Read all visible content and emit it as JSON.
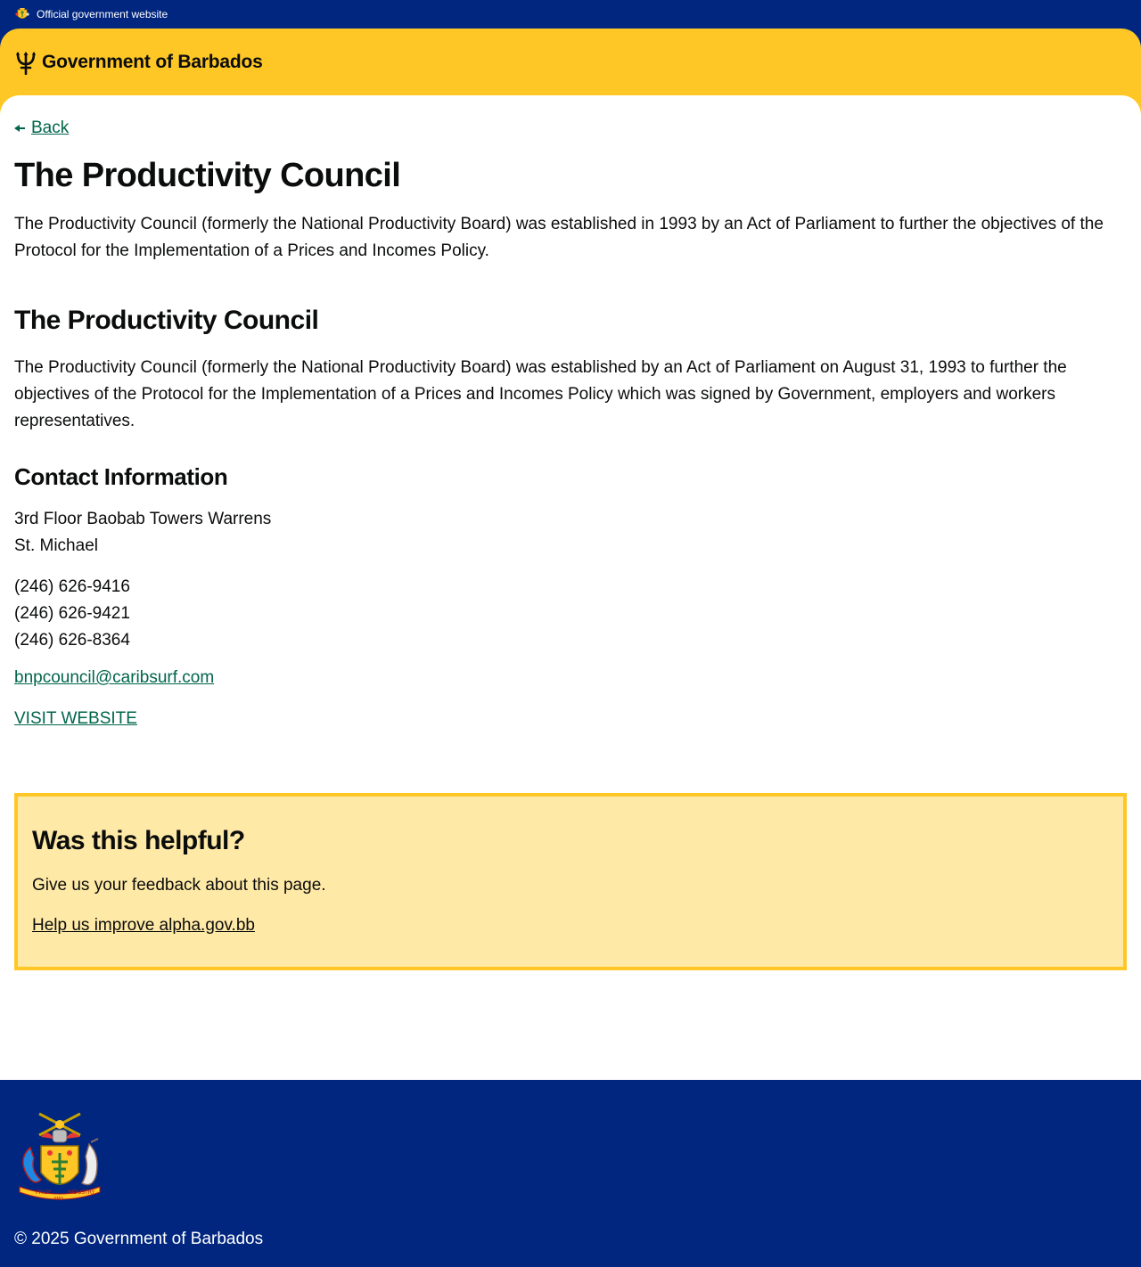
{
  "topbar": {
    "official_label": "Official government website"
  },
  "header": {
    "brand_name": "Government of Barbados"
  },
  "nav": {
    "back_label": "Back"
  },
  "page": {
    "title": "The Productivity Council",
    "lead": "The Productivity Council (formerly the National Productivity Board) was established in 1993 by an Act of Parliament to further the objectives of the Protocol for the Implementation of a Prices and Incomes Policy.",
    "section_heading": "The Productivity Council",
    "section_body": "The Productivity Council (formerly the National Productivity Board) was established by an Act of Parliament on August 31, 1993 to further the objectives of the Protocol for the Implementation of a Prices and Incomes Policy which was signed by Government, employers and workers representatives."
  },
  "contact": {
    "heading": "Contact Information",
    "address_line1": "3rd Floor Baobab Towers Warrens",
    "address_line2": "St. Michael",
    "phones": [
      "(246) 626-9416",
      "(246) 626-9421",
      "(246) 626-8364"
    ],
    "email": "bnpcouncil@caribsurf.com",
    "website_label": "VISIT WEBSITE"
  },
  "feedback": {
    "heading": "Was this helpful?",
    "text": "Give us your feedback about this page.",
    "link_label": "Help us improve alpha.gov.bb"
  },
  "footer": {
    "copyright": "© 2025 Government of Barbados",
    "coat_motto": [
      "PRIDE",
      "AND",
      "INDUSTRY"
    ]
  },
  "colors": {
    "navy": "#00267f",
    "gold": "#ffc726",
    "link_green": "#00654a",
    "feedback_bg": "#ffe9a6"
  },
  "icons": {
    "topbar": "barbados-crest-icon",
    "brand": "trident-icon",
    "back": "arrow-left-icon",
    "footer": "coat-of-arms-icon"
  }
}
